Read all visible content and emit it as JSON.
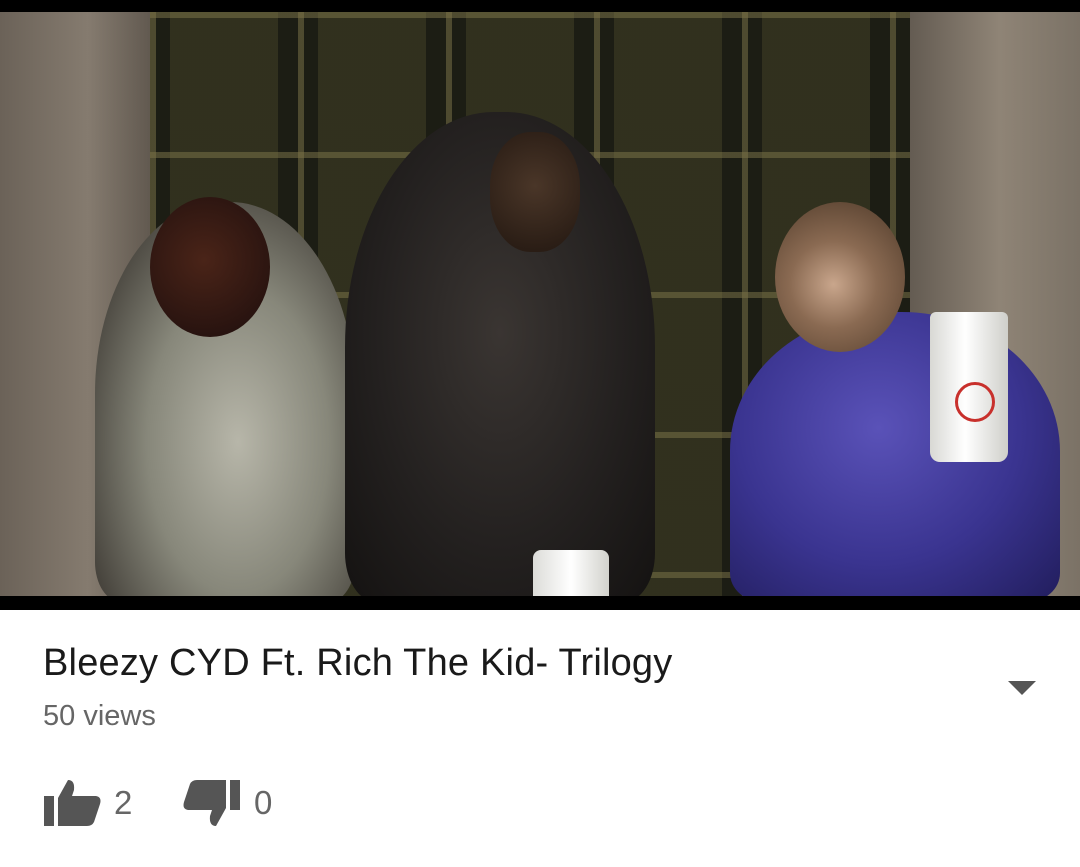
{
  "video": {
    "thumbnail_description": ""
  },
  "info": {
    "title": "Bleezy CYD Ft. Rich The Kid- Trilogy",
    "views": "50 views"
  },
  "actions": {
    "like_icon": "thumbs-up-icon",
    "like_count": "2",
    "dislike_icon": "thumbs-down-icon",
    "dislike_count": "0",
    "expand_icon": "chevron-down-icon"
  },
  "colors": {
    "title": "#1a1a1a",
    "secondary_text": "#666666",
    "icon": "#555555"
  }
}
